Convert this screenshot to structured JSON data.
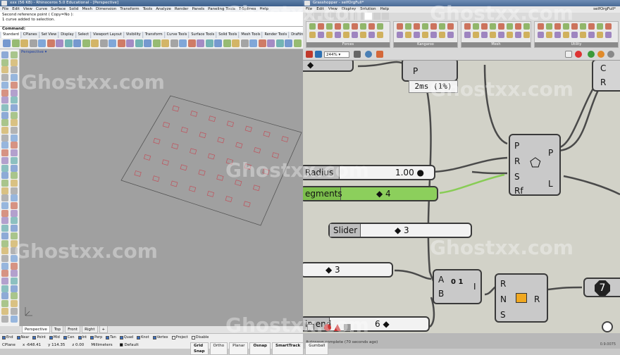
{
  "rhino": {
    "title": "xxx (56 KB) - Rhinoceros 5.0 Educational - [Perspective]",
    "menu": [
      "File",
      "Edit",
      "View",
      "Curve",
      "Surface",
      "Solid",
      "Mesh",
      "Dimension",
      "Transform",
      "Tools",
      "Analyze",
      "Render",
      "Panels",
      "Paneling Tools",
      "T-Splines",
      "Help"
    ],
    "command_history": [
      "Second reference point ( Copy=No ):",
      "1 curve added to selection."
    ],
    "command_prompt": "Command:",
    "toolbar_tabs": [
      "Standard",
      "CPlanes",
      "Set View",
      "Display",
      "Select",
      "Viewport Layout",
      "Visibility",
      "Transform",
      "Curve Tools",
      "Surface Tools",
      "Solid Tools",
      "Mesh Tools",
      "Render Tools",
      "Drafting"
    ],
    "viewport_label": "Perspective",
    "viewport_tabs": [
      "Perspective",
      "Top",
      "Front",
      "Right"
    ],
    "osnaps": [
      {
        "label": "End",
        "on": true
      },
      {
        "label": "Near",
        "on": true
      },
      {
        "label": "Point",
        "on": true
      },
      {
        "label": "Mid",
        "on": true
      },
      {
        "label": "Cen",
        "on": true
      },
      {
        "label": "Int",
        "on": true
      },
      {
        "label": "Perp",
        "on": true
      },
      {
        "label": "Tan",
        "on": true
      },
      {
        "label": "Quad",
        "on": true
      },
      {
        "label": "Knot",
        "on": true
      },
      {
        "label": "Vertex",
        "on": true
      },
      {
        "label": "Project",
        "on": false
      },
      {
        "label": "Disable",
        "on": false
      }
    ],
    "status": {
      "cplane": "CPlane",
      "x": "x -648.41",
      "y": "y 114.35",
      "z": "z 0.00",
      "units": "Millimeters",
      "layer": "Default"
    },
    "status_panes": [
      "Grid Snap",
      "Ortho",
      "Planar",
      "Osnap",
      "SmartTrack",
      "Gumball"
    ]
  },
  "grasshopper": {
    "title": "Grasshopper - selfOrgFull*",
    "menu": [
      "File",
      "Edit",
      "View",
      "Display",
      "Solution",
      "Help"
    ],
    "doc_name": "selfOrgFull*",
    "ribbon_groups": [
      "Forces",
      "Kangaroo",
      "Mesh",
      "Utility"
    ],
    "zoom": "244%",
    "tooltip": "2ms (1%)",
    "sliders": [
      {
        "label": "Radius",
        "value": "1.00"
      },
      {
        "label": "egments",
        "value": "4"
      },
      {
        "label": "Slider",
        "value": "3"
      },
      {
        "label": "",
        "value": "3"
      },
      {
        "label": "in end",
        "value": "6"
      }
    ],
    "component_ports": {
      "top_p": "P",
      "polygon_inputs": [
        "P",
        "R",
        "S",
        "Rf"
      ],
      "polygon_outputs": [
        "P",
        "L"
      ],
      "right_top_outputs": [
        "C",
        "R"
      ],
      "seq_inputs": [
        "A",
        "B"
      ],
      "seq_output": "I",
      "seq_icon": "0 1",
      "random_inputs": [
        "R",
        "N",
        "S"
      ],
      "random_output": "R",
      "panel_value": "7"
    },
    "autosave": "Autosave complete (70 seconds ago)",
    "version": "0.9.0075"
  },
  "watermark": "Ghostxx.com"
}
